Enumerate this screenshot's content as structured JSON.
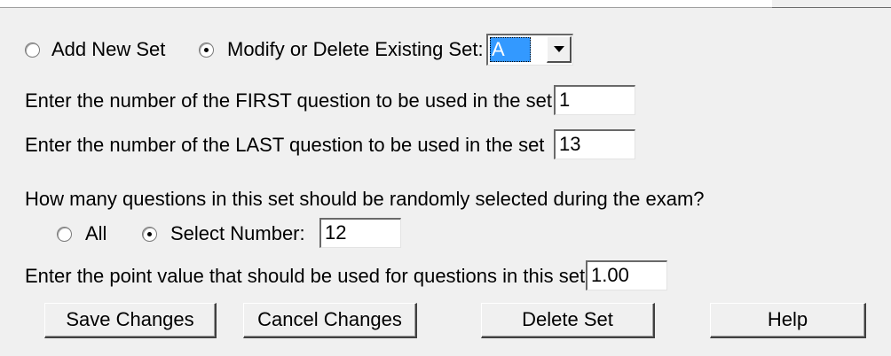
{
  "row1": {
    "add_new_set_label": "Add New Set",
    "add_new_set_checked": false,
    "modify_label": "Modify or Delete Existing Set:",
    "modify_checked": true,
    "set_dropdown_value": "A"
  },
  "first_question": {
    "label": "Enter the number of the FIRST question to be used in the set",
    "value": "1"
  },
  "last_question": {
    "label": "Enter the number of the LAST question to be used in the set",
    "value": "13"
  },
  "random_selection": {
    "prompt": "How many questions in this set should be randomly selected during the exam?",
    "all_label": "All",
    "all_checked": false,
    "select_number_label": "Select Number:",
    "select_number_checked": true,
    "select_number_value": "12"
  },
  "point_value": {
    "label": "Enter the point value that should be used for questions in this set",
    "value": "1.00"
  },
  "buttons": {
    "save": "Save Changes",
    "cancel": "Cancel Changes",
    "delete": "Delete Set",
    "help": "Help"
  },
  "colors": {
    "background": "#f0f0f0",
    "selection_highlight": "#3399ff"
  }
}
